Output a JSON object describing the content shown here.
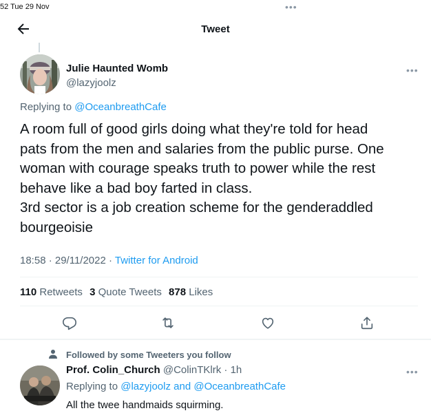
{
  "status_bar": {
    "time": "52   Tue 29 Nov",
    "dots": "•••"
  },
  "header": {
    "title": "Tweet"
  },
  "tweet": {
    "author_name": "Julie Haunted Womb",
    "author_handle": "@lazyjoolz",
    "more": "•••",
    "replying_prefix": "Replying to ",
    "replying_to": "@OceanbreathCafe",
    "lines": [
      "A room full of good girls doing what they're told for head",
      "pats from the men and salaries from the public purse. One",
      "woman with courage speaks truth to power while the rest",
      "behave like a bad boy farted in class.",
      "3rd sector is a job creation scheme for the genderaddled",
      "bourgeoisie"
    ],
    "timestamp": "18:58 · 29/11/2022 · ",
    "source": "Twitter for Android",
    "retweets": "110",
    "retweets_label": "Retweets",
    "quotes": "3",
    "quotes_label": "Quote Tweets",
    "likes": "878",
    "likes_label": "Likes"
  },
  "actions": [
    "reply-icon",
    "retweet-icon",
    "like-icon",
    "share-icon"
  ],
  "reply": {
    "social_context": "Followed by some Tweeters you follow",
    "name": "Prof. Colin_Church",
    "handle_time": " @ColinTKlrk · 1h",
    "more": "•••",
    "replying_prefix": "Replying to ",
    "replying_to_1": "@lazyjoolz",
    "replying_and": " and ",
    "replying_to_2": "@OceanbreathCafe",
    "text": "All the twee handmaids squirming."
  },
  "colors": {
    "accent": "#1d9bf0",
    "secondary_text": "#536471",
    "border": "#eff3f4"
  }
}
